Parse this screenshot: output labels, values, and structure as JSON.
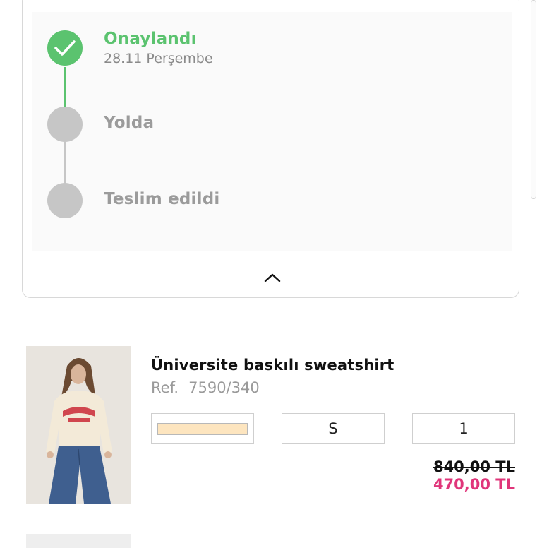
{
  "tracking": {
    "steps": [
      {
        "label": "Onaylandı",
        "date": "28.11 Perşembe",
        "state": "done",
        "color": "#5bc36f"
      },
      {
        "label": "Yolda",
        "state": "pending",
        "color": "#9b9b9b"
      },
      {
        "label": "Teslim edildi",
        "state": "pending",
        "color": "#9b9b9b"
      }
    ],
    "toggle_icon": "chevron-up-icon"
  },
  "product": {
    "title": "Üniversite baskılı sweatshirt",
    "ref_label": "Ref.",
    "ref_value": "7590/340",
    "image_icon": "product-photo",
    "color_swatch": "#fde5bf",
    "size": "S",
    "quantity": "1",
    "price_old": "840,00 TL",
    "price_new": "470,00 TL",
    "price_new_color": "#e0357a"
  }
}
